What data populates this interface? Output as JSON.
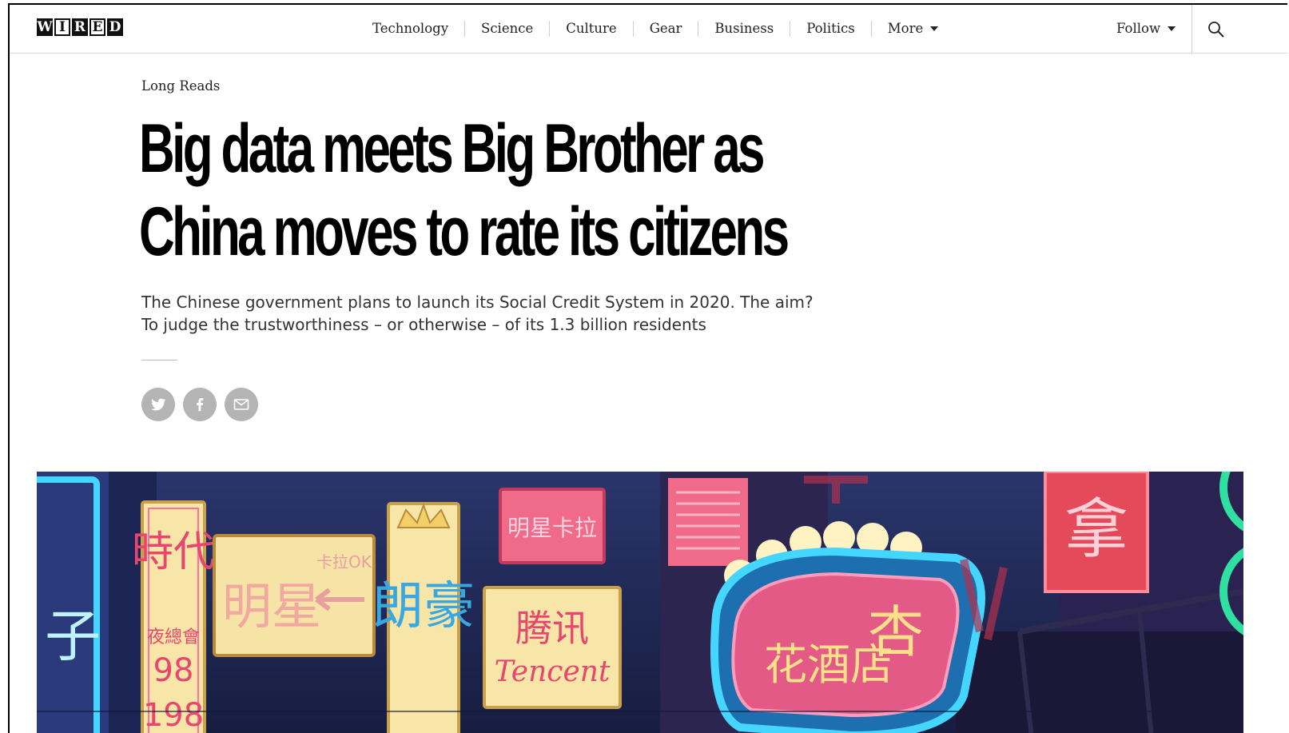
{
  "brand": {
    "logo_letters": [
      "W",
      "I",
      "R",
      "E",
      "D"
    ]
  },
  "nav": {
    "items": [
      "Technology",
      "Science",
      "Culture",
      "Gear",
      "Business",
      "Politics",
      "More"
    ],
    "follow_label": "Follow"
  },
  "article": {
    "section": "Long Reads",
    "headline_line1": "Big data meets Big Brother as",
    "headline_line2": "China moves to rate its citizens",
    "dek_line1": "The Chinese government plans to launch its Social Credit System in 2020. The aim?",
    "dek_line2": "To judge the trustworthiness – or otherwise – of its 1.3 billion residents"
  },
  "share": {
    "icons": [
      "twitter-icon",
      "facebook-icon",
      "email-icon"
    ]
  },
  "hero": {
    "sign_texts": [
      "時代",
      "明星",
      "卡拉OK",
      "夜總會",
      "98",
      "198",
      "朗豪",
      "明星卡拉",
      "腾讯",
      "Tencent",
      "花酒店",
      "杏",
      "拿"
    ],
    "colors": {
      "night": "#1f2a55",
      "neon_pink": "#ff6fa0",
      "neon_cyan": "#45d6ff",
      "sign_cream": "#f8e6a8",
      "neon_green": "#2fe0a0"
    }
  }
}
